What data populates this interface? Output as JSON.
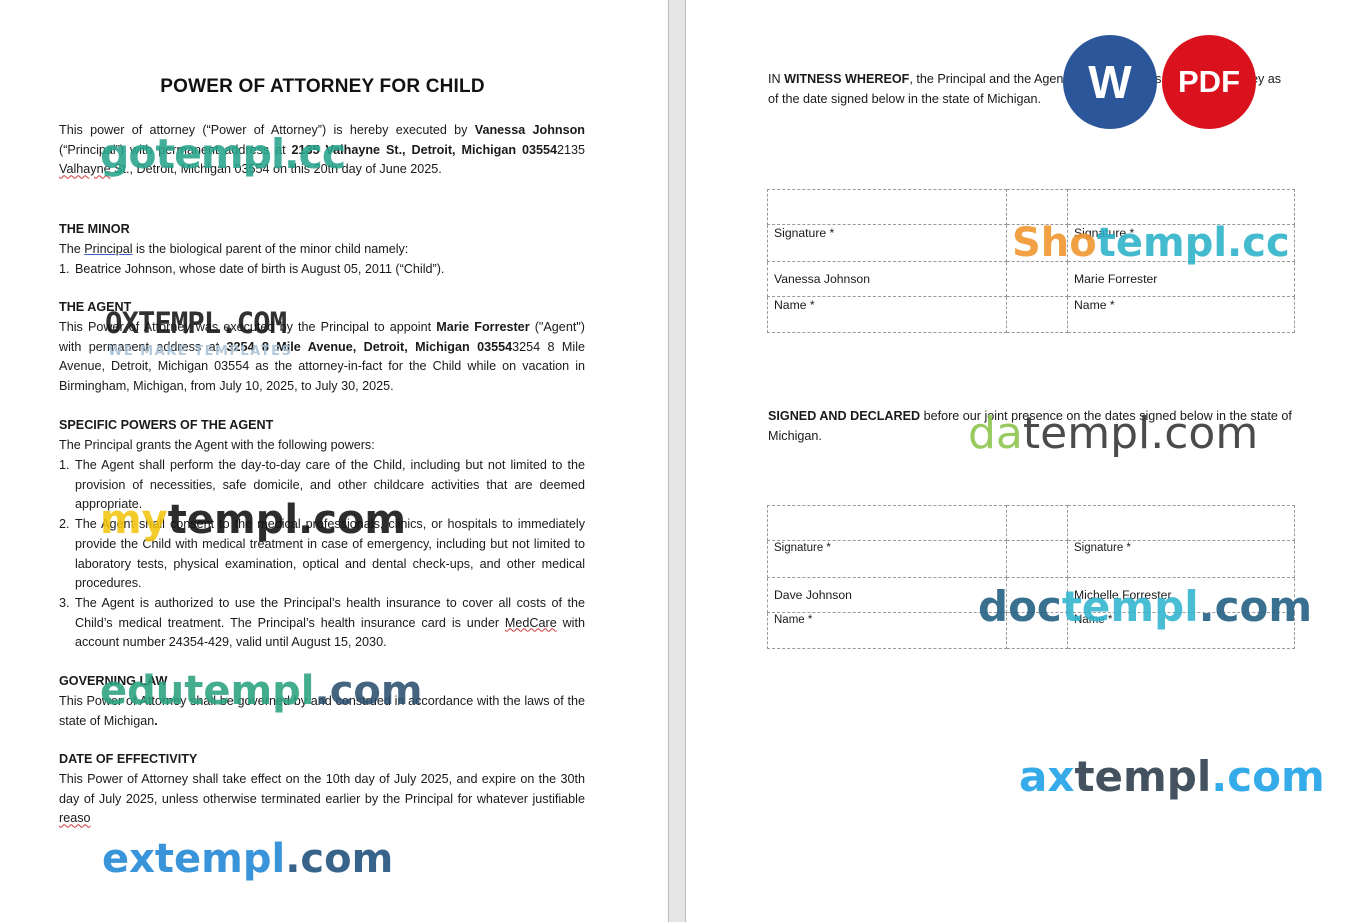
{
  "title": "POWER OF ATTORNEY FOR CHILD",
  "intro": {
    "t1": "This power of attorney (“Power of Attorney”) is hereby executed by ",
    "principal_name": "Vanessa Johnson",
    "t2": " (“Principal”) with permanent address at ",
    "principal_address_bold": "2135 Valhayne St., Detroit, Michigan 03554",
    "t3": "2135 ",
    "t3_squig": "Valhayne",
    "t4": " St., Detroit, Michigan 03554 on this 20th day of June 2025."
  },
  "minor": {
    "heading": "THE MINOR",
    "t1": "The ",
    "principal_word": "Principal",
    "t2": " is the biological parent of the minor child namely:",
    "item_num": "1.",
    "item": "Beatrice Johnson, whose date of birth is August 05, 2011 (“Child”)."
  },
  "agent": {
    "heading": "THE AGENT",
    "t1": "This Power of Attorney was executed by the Principal to appoint ",
    "agent_name": "Marie Forrester",
    "t2": " (\"Agent\") with permanent address at ",
    "agent_address_bold": "3254 8 Mile Avenue, Detroit, Michigan 03554",
    "t3": "3254 8 Mile Avenue, Detroit, Michigan 03554 as the attorney-in-fact for the Child while on vacation in Birmingham, Michigan, from July 10, 2025, to July 30, 2025."
  },
  "powers": {
    "heading": "SPECIFIC POWERS OF THE AGENT",
    "intro": "The Principal grants the Agent with the following powers:",
    "items": [
      {
        "num": "1.",
        "text": "The Agent shall perform the day-to-day care of the Child, including but not limited to the provision of necessities, safe domicile, and other childcare activities that are deemed appropriate."
      },
      {
        "num": "2.",
        "text": "The Agent shall consent to the medical professionals, clinics, or hospitals to immediately provide the Child with medical treatment in case of emergency, including but not limited to laboratory tests, physical examination, optical and dental check-ups, and other medical procedures."
      },
      {
        "num": "3.",
        "text_a": "The Agent is authorized to use the Principal’s health insurance to cover all costs of the Child’s medical treatment. The Principal’s health insurance card is under ",
        "text_squig": "MedCare",
        "text_b": " with account number 24354-429, valid until August 15, 2030."
      }
    ]
  },
  "law": {
    "heading": "GOVERNING LAW",
    "t1": "This Power of Attorney shall be governed by and construed in accordance with the laws of the state of Michigan",
    "t1_end": "."
  },
  "effectivity": {
    "heading": "DATE OF EFFECTIVITY",
    "t1": "This Power of Attorney shall take effect on the 10th day of July 2025, and expire on the 30th day of July 2025, unless otherwise terminated earlier by the Principal for whatever justifiable ",
    "t_squig": "reaso"
  },
  "witness": {
    "t_in": "IN ",
    "t_bold": "WITNESS WHEREOF",
    "t_rest": ", the Principal and the Agent have signed this Power of Attorney as of the date signed below in the state of Michigan."
  },
  "table1": {
    "sig_label_left": "Signature *",
    "sig_label_right": "Signature *",
    "name_left": "Vanessa Johnson",
    "name_right": "Marie Forrester",
    "name_label_left": "Name *",
    "name_label_right": "Name *"
  },
  "declared": {
    "t_bold": "SIGNED AND DECLARED",
    "t_rest": " before our joint presence on the dates signed below in the state of Michigan."
  },
  "table2": {
    "sig_label_left": "Signature *",
    "sig_label_right": "Signature *",
    "name_left": "Dave Johnson",
    "name_right": "Michelle Forrester",
    "name_label_left": "Name *",
    "name_label_right": "Name *"
  },
  "badges": {
    "word": "W",
    "pdf": "PDF",
    "word_color": "#2b579a",
    "pdf_color": "#d9121e"
  },
  "watermarks": {
    "gotempl": "gotempl.cc",
    "oxtempl": "OXTEMPL.COM",
    "oxtempl_sub": "WE MAKE TEMPLATES",
    "mytempl_a": "my",
    "mytempl_b": "templ.com",
    "edutempl_a": "edutempl",
    "edutempl_b": ".com",
    "extempl_a": "extempl",
    "extempl_b": ".com",
    "shotempl_a": "Sho",
    "shotempl_b": "templ.cc",
    "datempl_a": "da",
    "datempl_b": "templ.com",
    "doctempl_a": "doc",
    "doctempl_b": "templ",
    "doctempl_c": ".com",
    "axtempl_a": "ax",
    "axtempl_b": "templ",
    "axtempl_c": ".com"
  }
}
